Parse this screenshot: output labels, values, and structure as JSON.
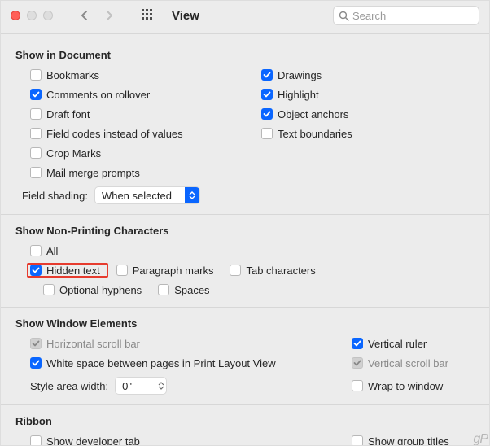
{
  "toolbar": {
    "title": "View",
    "search_placeholder": "Search"
  },
  "sections": {
    "show_in_document": {
      "title": "Show in Document",
      "left": [
        {
          "label": "Bookmarks",
          "checked": false
        },
        {
          "label": "Comments on rollover",
          "checked": true
        },
        {
          "label": "Draft font",
          "checked": false
        },
        {
          "label": "Field codes instead of values",
          "checked": false
        },
        {
          "label": "Crop Marks",
          "checked": false
        },
        {
          "label": "Mail merge prompts",
          "checked": false
        }
      ],
      "right": [
        {
          "label": "Drawings",
          "checked": true
        },
        {
          "label": "Highlight",
          "checked": true
        },
        {
          "label": "Object anchors",
          "checked": true
        },
        {
          "label": "Text boundaries",
          "checked": false
        }
      ],
      "shading_label": "Field shading:",
      "shading_value": "When selected"
    },
    "nonprinting": {
      "title": "Show Non-Printing Characters",
      "row1": [
        {
          "label": "All",
          "checked": false
        }
      ],
      "row2": [
        {
          "label": "Hidden text",
          "checked": true,
          "highlight": true
        },
        {
          "label": "Paragraph marks",
          "checked": false
        },
        {
          "label": "Tab characters",
          "checked": false
        }
      ],
      "row3": [
        {
          "label": "Optional hyphens",
          "checked": false
        },
        {
          "label": "Spaces",
          "checked": false
        }
      ]
    },
    "window_elements": {
      "title": "Show Window Elements",
      "horizontal_scroll": {
        "label": "Horizontal scroll bar",
        "checked": true,
        "disabled": true
      },
      "vertical_ruler": {
        "label": "Vertical ruler",
        "checked": true
      },
      "white_space": {
        "label": "White space between pages in Print Layout View",
        "checked": true
      },
      "vertical_scroll": {
        "label": "Vertical scroll bar",
        "checked": true,
        "disabled": true
      },
      "style_label": "Style area width:",
      "style_value": "0\"",
      "wrap": {
        "label": "Wrap to window",
        "checked": false
      }
    },
    "ribbon": {
      "title": "Ribbon",
      "dev": {
        "label": "Show developer tab",
        "checked": false
      },
      "groups": {
        "label": "Show group titles",
        "checked": false
      }
    }
  },
  "watermark": "gP"
}
